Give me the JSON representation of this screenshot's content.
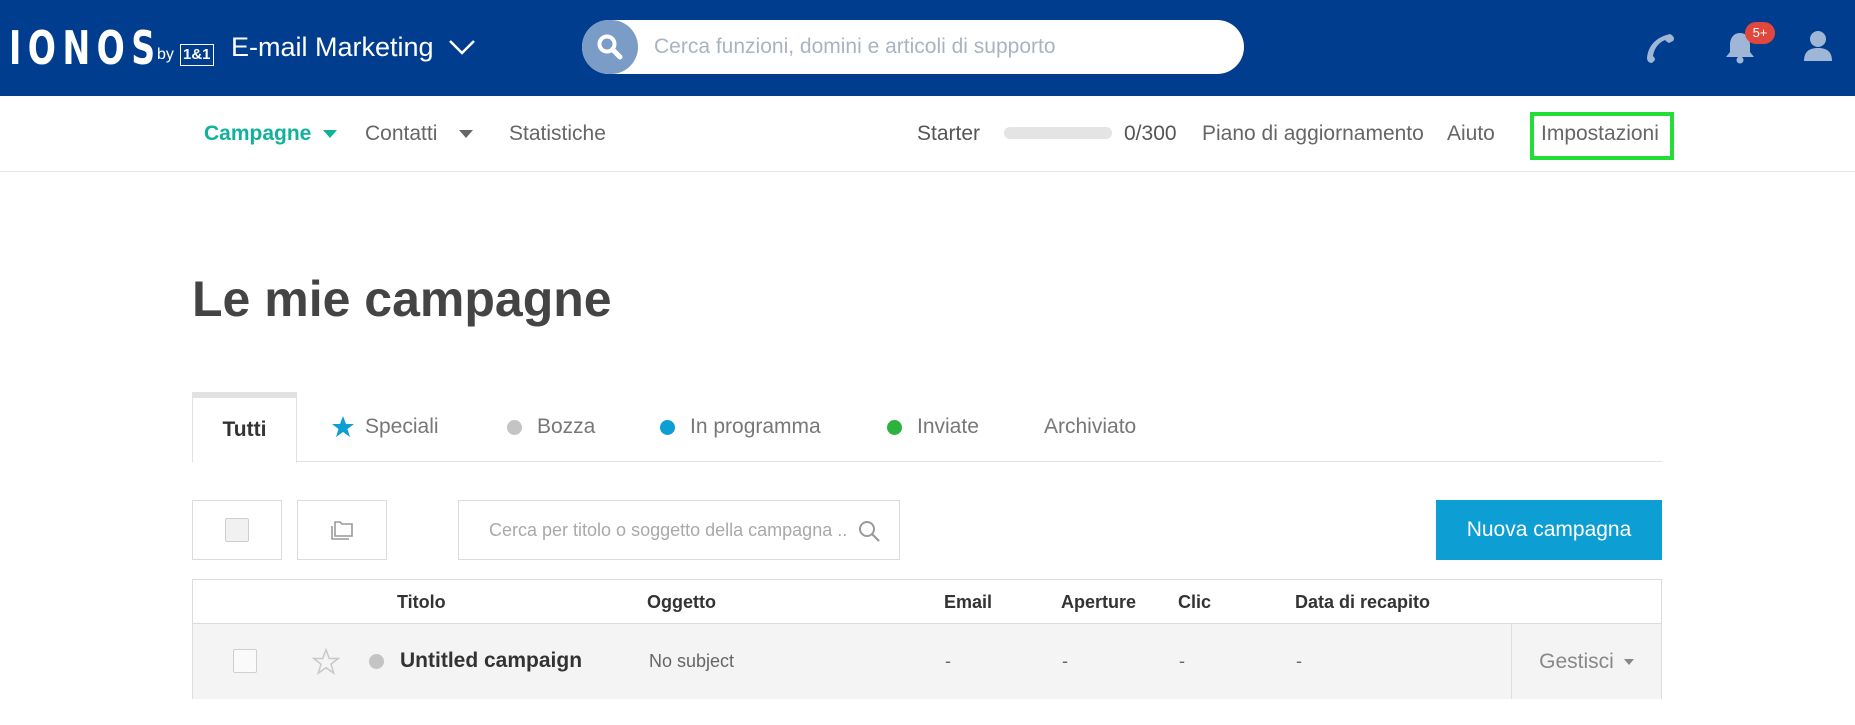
{
  "colors": {
    "header_bg": "#003d8f",
    "accent_green": "#11b29a",
    "primary_button": "#0d9ed3",
    "badge_red": "#e0483e",
    "highlight_box": "#22dd33",
    "dot_draft": "#c4c4c4",
    "dot_scheduled": "#0d9ed3",
    "dot_sent": "#2eb23e",
    "star_blue": "#0d9ed3"
  },
  "header": {
    "logo_word": "IONOS",
    "logo_by": "by",
    "logo_brand": "1&1",
    "product": "E-mail Marketing",
    "product_chevron_icon": "chevron-down-icon",
    "search_placeholder": "Cerca funzioni, domini e articoli di supporto",
    "icons": [
      "search-icon",
      "phone-icon",
      "bell-icon",
      "user-icon"
    ],
    "notifications_badge": "5+"
  },
  "subnav": {
    "campaigns": "Campagne",
    "contacts": "Contatti",
    "statistics": "Statistiche",
    "plan": "Starter",
    "usage_text": "0/300",
    "usage_fraction": 0,
    "upgrade": "Piano di aggiornamento",
    "help": "Aiuto",
    "settings": "Impostazioni"
  },
  "main": {
    "title": "Le mie campagne",
    "tabs": [
      {
        "label": "Tutti"
      },
      {
        "label": "Speciali",
        "icon": "star-icon"
      },
      {
        "label": "Bozza",
        "icon": "dot-icon"
      },
      {
        "label": "In programma",
        "icon": "dot-icon"
      },
      {
        "label": "Inviate",
        "icon": "dot-icon"
      },
      {
        "label": "Archiviato"
      }
    ],
    "search_placeholder": "Cerca per titolo o soggetto della campagna ..",
    "new_campaign": "Nuova campagna"
  },
  "table": {
    "headers": [
      "Titolo",
      "Oggetto",
      "Email",
      "Aperture",
      "Clic",
      "Data di recapito"
    ],
    "rows": [
      {
        "title": "Untitled campaign",
        "subject": "No subject",
        "email": "-",
        "opens": "-",
        "clicks": "-",
        "delivery_date": "-",
        "manage": "Gestisci"
      }
    ]
  }
}
